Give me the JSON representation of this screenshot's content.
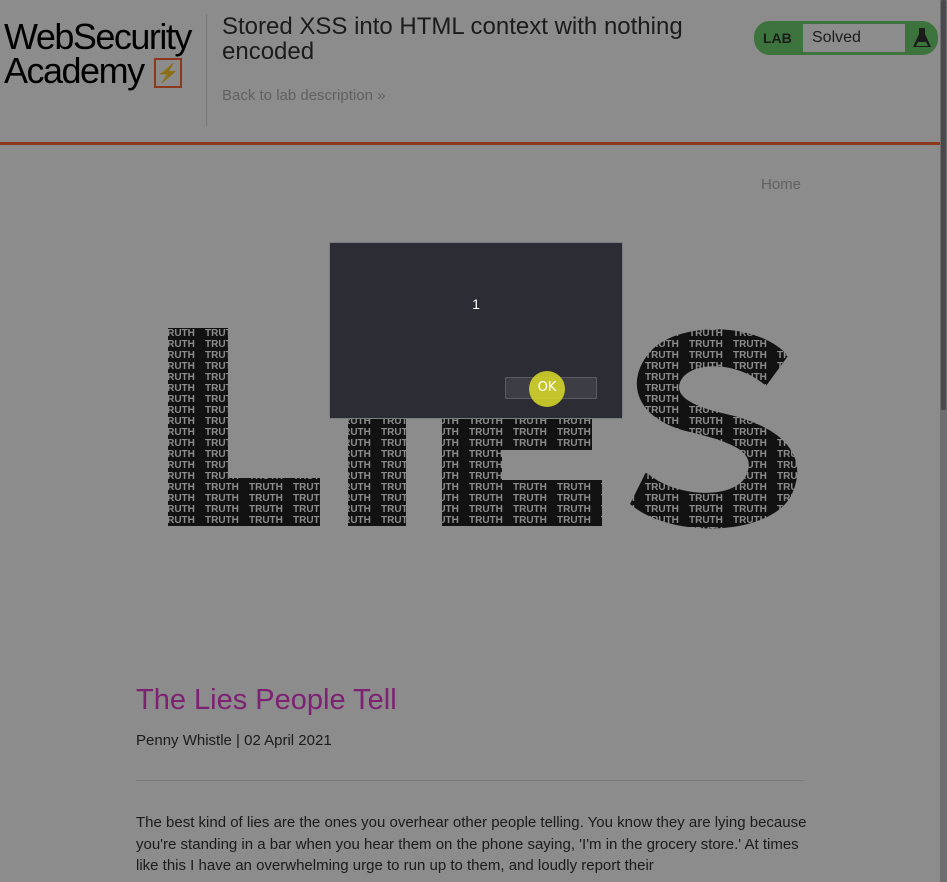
{
  "header": {
    "logo_line1": "WebSecurity",
    "logo_line2": "Academy",
    "logo_mark": "⚡",
    "lab_title": "Stored XSS into HTML context with nothing encoded",
    "back_link": "Back to lab description »",
    "status_tag": "LAB",
    "status_value": "Solved",
    "status_icon": "flask-icon",
    "accent_color": "#ff6633",
    "solved_color": "#70d16d"
  },
  "nav": {
    "home": "Home"
  },
  "banner": {
    "letters": [
      "L",
      "I",
      "E",
      "S"
    ],
    "fill_word": "TRUTH"
  },
  "post": {
    "title": "The Lies People Tell",
    "byline": "Penny Whistle | 02 April 2021",
    "title_color": "#e33cd0",
    "body": "The best kind of lies are the ones you overhear other people telling. You know they are lying because you're standing in a bar when you hear them on the phone saying, 'I'm in the grocery store.' At times like this I have an overwhelming urge to run up to them, and loudly report their"
  },
  "dialog": {
    "message": "1",
    "ok_label": "OK"
  }
}
